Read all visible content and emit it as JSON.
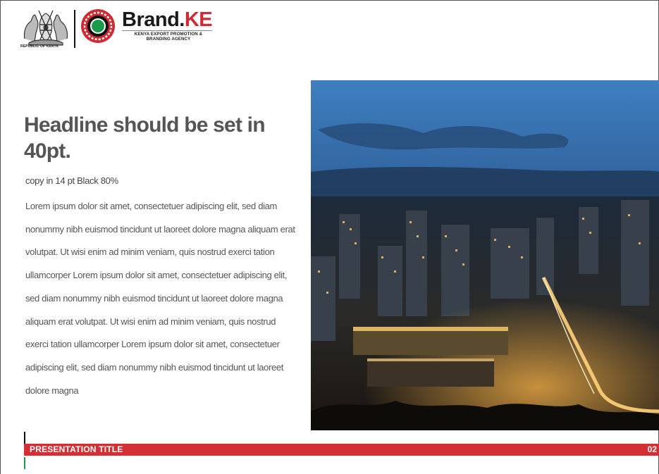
{
  "header": {
    "coat_caption": "REPUBLIC OF KENYA",
    "brand_name_main": "Brand.",
    "brand_name_accent": "KE",
    "brand_tagline": "KENYA EXPORT PROMOTION & BRANDING AGENCY"
  },
  "content": {
    "headline": "Headline should be set in 40pt.",
    "subnote": "copy in 14 pt Black 80%",
    "body": "Lorem ipsum dolor sit amet, consectetuer adipiscing elit, sed diam nonummy nibh euismod tincidunt ut laoreet dolore magna aliquam erat volutpat. Ut wisi enim ad minim veniam, quis nostrud exerci tation ullamcorper Lorem ipsum dolor sit amet, consectetuer adipiscing elit, sed diam nonummy nibh euismod tincidunt ut laoreet dolore magna aliquam erat volutpat. Ut wisi enim ad minim veniam, quis nostrud exerci tation ullamcorper  Lorem ipsum dolor sit amet, consectetuer adipiscing elit, sed diam nonummy nibh euismod tincidunt ut laoreet dolore magna"
  },
  "footer": {
    "title": "PRESENTATION TITLE",
    "page_number": "02"
  },
  "colors": {
    "accent_red": "#d32f34",
    "accent_green": "#1a9a4a",
    "headline_gray": "#555555"
  }
}
